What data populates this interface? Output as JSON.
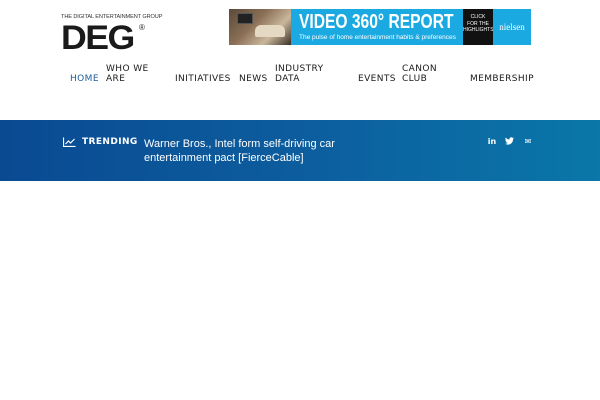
{
  "logo": {
    "subtitle": "THE DIGITAL ENTERTAINMENT GROUP",
    "name": "DEG",
    "reg": "®"
  },
  "ad": {
    "title": "VIDEO 360° REPORT",
    "subtitle": "The pulse of home entertainment habits & preferences",
    "click": [
      "CLICK",
      "FOR THE",
      "HIGHLIGHTS"
    ],
    "brand": "nielsen"
  },
  "nav": {
    "items": [
      {
        "label": "HOME",
        "line2": "",
        "active": true
      },
      {
        "label": "WHO WE",
        "line2": "ARE",
        "active": false
      },
      {
        "label": "INITIATIVES",
        "line2": "",
        "active": false
      },
      {
        "label": "NEWS",
        "line2": "",
        "active": false
      },
      {
        "label": "INDUSTRY",
        "line2": "DATA",
        "active": false
      },
      {
        "label": "EVENTS",
        "line2": "",
        "active": false
      },
      {
        "label": "CANON",
        "line2": "CLUB",
        "active": false
      },
      {
        "label": "MEMBERSHIP",
        "line2": "",
        "active": false
      }
    ]
  },
  "trending": {
    "label": "TRENDING",
    "headline": "Warner Bros., Intel form self-driving car entertainment pact [FierceCable]",
    "social": [
      {
        "icon": "linkedin-icon",
        "glyph": "in"
      },
      {
        "icon": "twitter-icon",
        "glyph": "t"
      },
      {
        "icon": "email-icon",
        "glyph": "✉"
      }
    ]
  },
  "colors": {
    "accent": "#1c5d9a",
    "trend_bar_start": "#0a4a92",
    "trend_bar_end": "#0a77a8",
    "ad_blue": "#1ba9e1"
  }
}
